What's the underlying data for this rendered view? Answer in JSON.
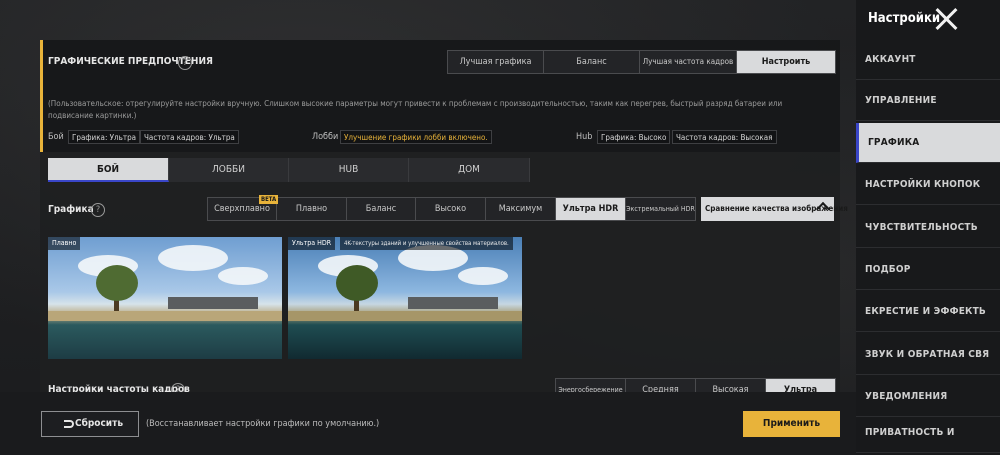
{
  "sidebar": {
    "title": "Настройки",
    "items": [
      {
        "label": "АККАУНТ"
      },
      {
        "label": "УПРАВЛЕНИЕ"
      },
      {
        "label": "ГРАФИКА"
      },
      {
        "label": "НАСТРОЙКИ КНОПОК"
      },
      {
        "label": "ЧУВСТВИТЕЛЬНОСТЬ"
      },
      {
        "label": "ПОДБОР"
      },
      {
        "label": "ЕКРЕСТИЕ И ЭФФЕКТЬ"
      },
      {
        "label": "ЗВУК И ОБРАТНАЯ СВЯ"
      },
      {
        "label": "УВЕДОМЛЕНИЯ"
      },
      {
        "label": "ПРИВАТНОСТЬ И"
      }
    ],
    "active_index": 2
  },
  "preferences": {
    "title": "ГРАФИЧЕСКИЕ ПРЕДПОЧТЕНИЯ",
    "help": "?",
    "options": [
      "Лучшая графика",
      "Баланс",
      "Лучшая частота кадров",
      "Настроить"
    ],
    "selected": "Настроить",
    "description": "(Пользовательское: отрегулируйте настройки вручную. Слишком высокие параметры могут привести к проблемам с производительностью, таким как перегрев, быстрый разряд батареи или подвисание картинки.)",
    "current": {
      "battle_label": "Бой",
      "battle_graphics": "Графика: Ультра",
      "battle_fps": "Частота кадров: Ультра",
      "lobby_label": "Лобби",
      "lobby_value": "Улучшение графики лобби включено.",
      "hub_label": "Hub",
      "hub_graphics": "Графика: Высоко",
      "hub_fps": "Частота кадров: Высокая"
    }
  },
  "tabs": [
    "БОЙ",
    "ЛОББИ",
    "HUB",
    "ДОМ"
  ],
  "active_tab": "БОЙ",
  "graphics": {
    "label": "Графика",
    "help": "?",
    "options": [
      "Сверхплавно",
      "Плавно",
      "Баланс",
      "Высоко",
      "Максимум",
      "Ультра HDR",
      "Экстремальный HDR"
    ],
    "selected": "Ультра HDR",
    "beta_badge": "BETA",
    "compare_label": "Сравнение качества изображения"
  },
  "previews": [
    {
      "tag": "Плавно",
      "desc": ""
    },
    {
      "tag": "Ультра HDR",
      "desc": "4K-текстуры зданий и улучшенные свойства материалов."
    }
  ],
  "fps": {
    "label": "Настройки частоты кадров",
    "help": "?",
    "options": [
      "Энергосбережение",
      "Средняя",
      "Высокая",
      "Ультра"
    ],
    "selected": "Ультра"
  },
  "footer": {
    "reset_label": "Сбросить",
    "reset_note": "(Восстанавливает настройки графики по умолчанию.)",
    "apply_label": "Применить"
  },
  "colors": {
    "accent": "#e8b33a",
    "active_bg": "#d9dadc",
    "active_marker": "#3a46c8"
  }
}
